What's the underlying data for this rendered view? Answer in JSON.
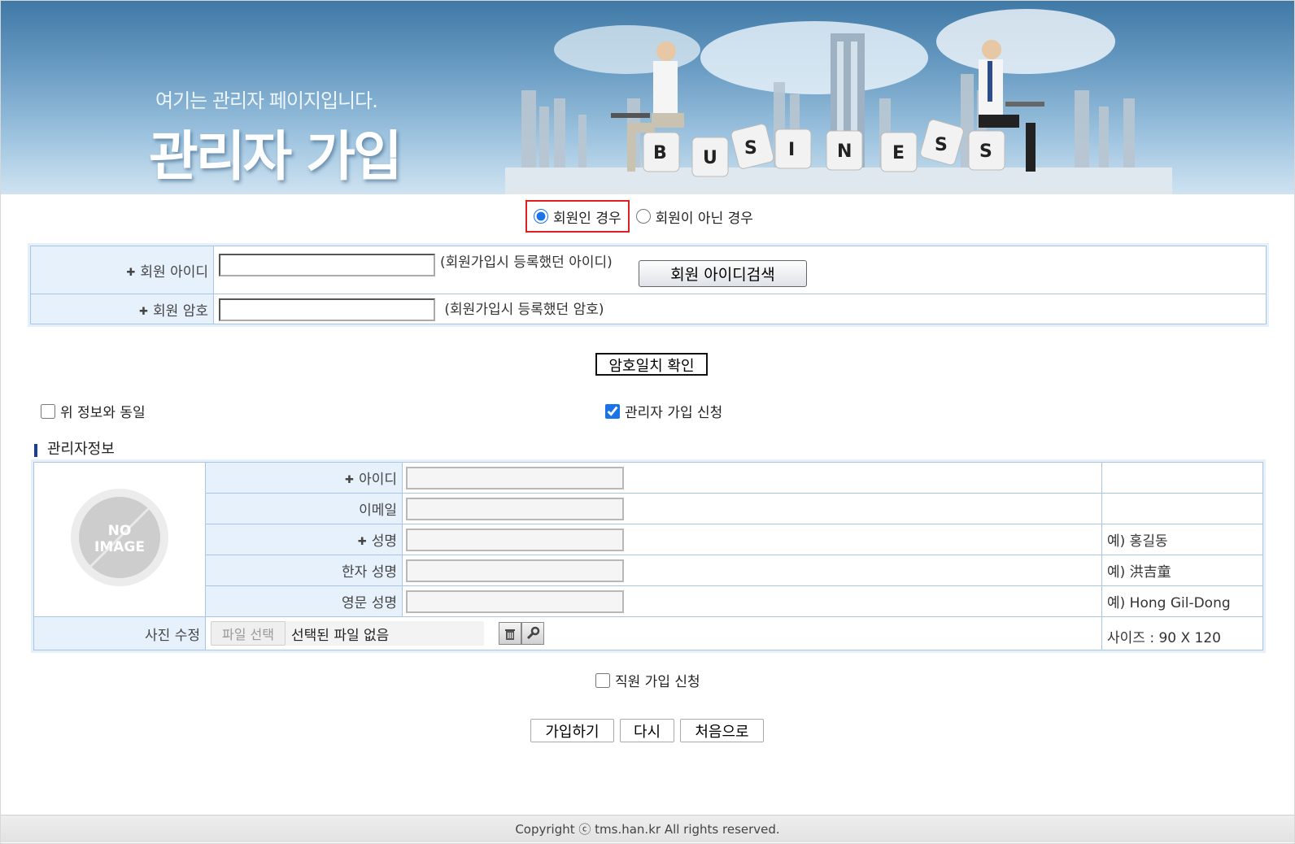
{
  "banner": {
    "subtitle": "여기는 관리자 페이지입니다.",
    "title": "관리자 가입",
    "image_letters": [
      "B",
      "U",
      "S",
      "I",
      "N",
      "E",
      "S",
      "S"
    ]
  },
  "member_choice": {
    "option_member": "회원인 경우",
    "option_non_member": "회원이 아닌 경우",
    "selected": "회원인 경우"
  },
  "member_login": {
    "id_label": "회원 아이디",
    "id_value": "",
    "id_hint": "(회원가입시 등록했던 아이디)",
    "id_search_button": "회원 아이디검색",
    "pw_label": "회원 암호",
    "pw_value": "",
    "pw_hint": "(회원가입시 등록했던 암호)",
    "confirm_button": "암호일치 확인"
  },
  "options": {
    "same_as_above": "위 정보와 동일",
    "same_as_above_checked": false,
    "admin_apply": "관리자 가입 신청",
    "admin_apply_checked": true
  },
  "admin_info": {
    "section_title": "관리자정보",
    "photo_placeholder": [
      "NO",
      "IMAGE"
    ],
    "fields": [
      {
        "label": "아이디",
        "required": true,
        "value": "",
        "example": ""
      },
      {
        "label": "이메일",
        "required": false,
        "value": "",
        "example": ""
      },
      {
        "label": "성명",
        "required": true,
        "value": "",
        "example": "예) 홍길동"
      },
      {
        "label": "한자 성명",
        "required": false,
        "value": "",
        "example": "예) 洪吉童"
      },
      {
        "label": "영문 성명",
        "required": false,
        "value": "",
        "example": "예) Hong Gil-Dong"
      }
    ],
    "photo_edit_label": "사진 수정",
    "file_button": "파일 선택",
    "file_status": "선택된 파일 없음",
    "size_note": "사이즈 : 90 X 120"
  },
  "staff_apply": {
    "label": "직원 가입 신청",
    "checked": false
  },
  "actions": {
    "join": "가입하기",
    "reset": "다시",
    "home": "처음으로"
  },
  "footer": {
    "copyright": "Copyright ⓒ tms.han.kr All rights reserved."
  },
  "colors": {
    "accent": "#1a73e8",
    "highlight_border": "#e02020",
    "label_bg": "#e7f1fc",
    "table_border": "#a9c5e6",
    "section_bar": "#1a3f8c"
  }
}
